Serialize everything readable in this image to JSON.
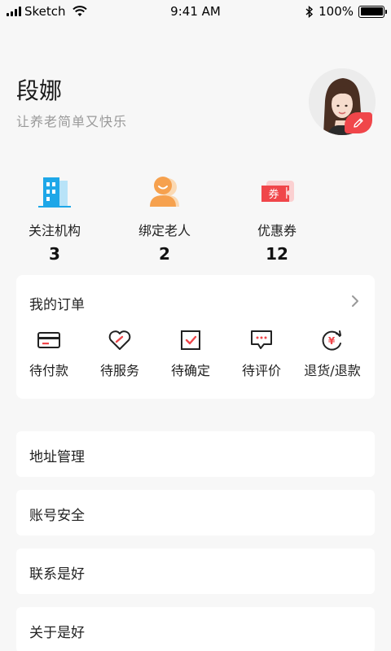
{
  "status_bar": {
    "carrier": "Sketch",
    "time": "9:41 AM",
    "battery": "100%",
    "battery_level": 1.0
  },
  "profile": {
    "name": "段娜",
    "slogan": "让养老简单又快乐"
  },
  "stats": [
    {
      "label": "关注机构",
      "value": "3",
      "icon": "building-icon"
    },
    {
      "label": "绑定老人",
      "value": "2",
      "icon": "elder-icon"
    },
    {
      "label": "优惠券",
      "value": "12",
      "icon": "coupon-icon",
      "icon_text": "券"
    }
  ],
  "orders": {
    "title": "我的订单",
    "items": [
      {
        "label": "待付款",
        "icon": "card-icon"
      },
      {
        "label": "待服务",
        "icon": "heart-icon"
      },
      {
        "label": "待确定",
        "icon": "check-box-icon"
      },
      {
        "label": "待评价",
        "icon": "comment-icon"
      },
      {
        "label": "退货/退款",
        "icon": "refund-icon",
        "icon_text": "¥"
      }
    ]
  },
  "menu": [
    {
      "label": "地址管理"
    },
    {
      "label": "账号安全"
    },
    {
      "label": "联系是好"
    },
    {
      "label": "关于是好"
    }
  ],
  "colors": {
    "accent": "#f0464a",
    "background": "#f7f7f7",
    "card": "#ffffff",
    "muted_text": "#9a9a9a",
    "building_blue": "#1ea7e8",
    "elder_orange": "#f6a14e"
  }
}
